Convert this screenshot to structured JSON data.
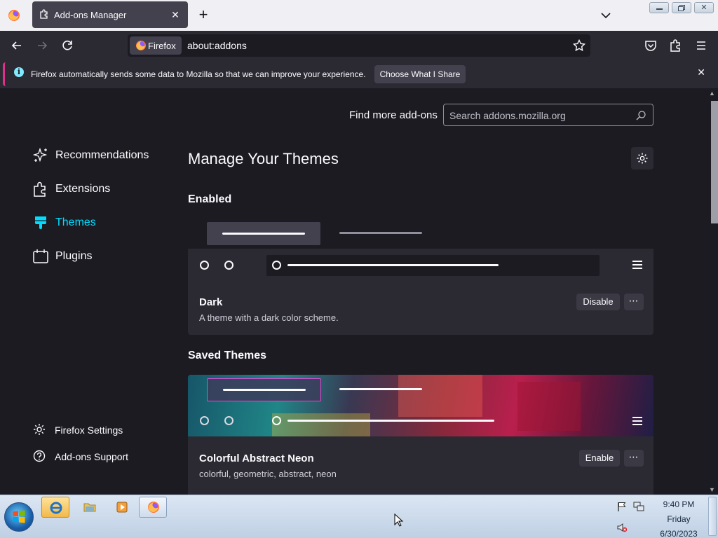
{
  "browser": {
    "tab_title": "Add-ons Manager",
    "identity_label": "Firefox",
    "url": "about:addons"
  },
  "infobar": {
    "message": "Firefox automatically sends some data to Mozilla so that we can improve your experience.",
    "action_label": "Choose What I Share"
  },
  "addons": {
    "find_more_label": "Find more add-ons",
    "search_placeholder": "Search addons.mozilla.org",
    "search_value": "",
    "nav": [
      {
        "label": "Recommendations",
        "icon": "sparkle-icon"
      },
      {
        "label": "Extensions",
        "icon": "puzzle-icon"
      },
      {
        "label": "Themes",
        "icon": "brush-icon",
        "active": true
      },
      {
        "label": "Plugins",
        "icon": "plugin-icon"
      }
    ],
    "footer": [
      {
        "label": "Firefox Settings",
        "icon": "gear-icon"
      },
      {
        "label": "Add-ons Support",
        "icon": "help-icon"
      }
    ],
    "page_title": "Manage Your Themes",
    "enabled_heading": "Enabled",
    "saved_heading": "Saved Themes",
    "enabled_theme": {
      "name": "Dark",
      "description": "A theme with a dark color scheme.",
      "action_label": "Disable",
      "more_label": "⋯"
    },
    "saved_theme": {
      "name": "Colorful Abstract Neon",
      "description": "colorful, geometric, abstract, neon",
      "action_label": "Enable",
      "more_label": "⋯"
    }
  },
  "taskbar": {
    "time": "9:40 PM",
    "day": "Friday",
    "date": "6/30/2023"
  },
  "colors": {
    "accent_active": "#00ddff",
    "page_bg": "#1c1b22",
    "card_bg": "#2b2a33",
    "infobar_accent": "#e0308a"
  }
}
